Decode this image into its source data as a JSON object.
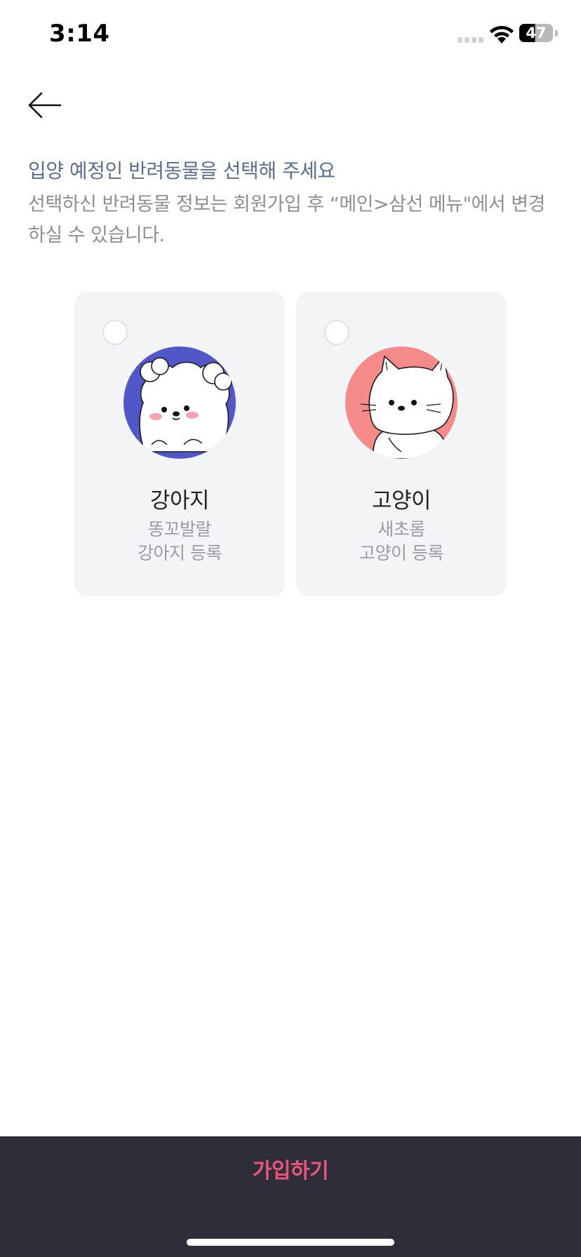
{
  "status_bar": {
    "time": "3:14",
    "battery_percent": "47",
    "battery_level": 0.47
  },
  "nav": {
    "back_icon": "arrow-left-icon"
  },
  "header": {
    "title": "입양 예정인 반려동물을 선택해 주세요",
    "description": "선택하신 반려동물 정보는 회원가입 후 “메인>삼선 메뉴\"에서 변경하실 수 있습니다."
  },
  "pets": [
    {
      "name": "강아지",
      "subtitle_line1": "똥꼬발랄",
      "subtitle_line2": "강아지 등록",
      "avatar_color": "#5157c8",
      "icon": "dog-icon",
      "selected": false
    },
    {
      "name": "고양이",
      "subtitle_line1": "새초롬",
      "subtitle_line2": "고양이 등록",
      "avatar_color": "#f48a8a",
      "icon": "cat-icon",
      "selected": false
    }
  ],
  "footer": {
    "join_label": "가입하기"
  },
  "colors": {
    "title": "#5a6d93",
    "description": "#8d8f94",
    "card_bg": "#f3f4f6",
    "bottom_bar": "#2d2e3a",
    "accent": "#e8577a"
  }
}
